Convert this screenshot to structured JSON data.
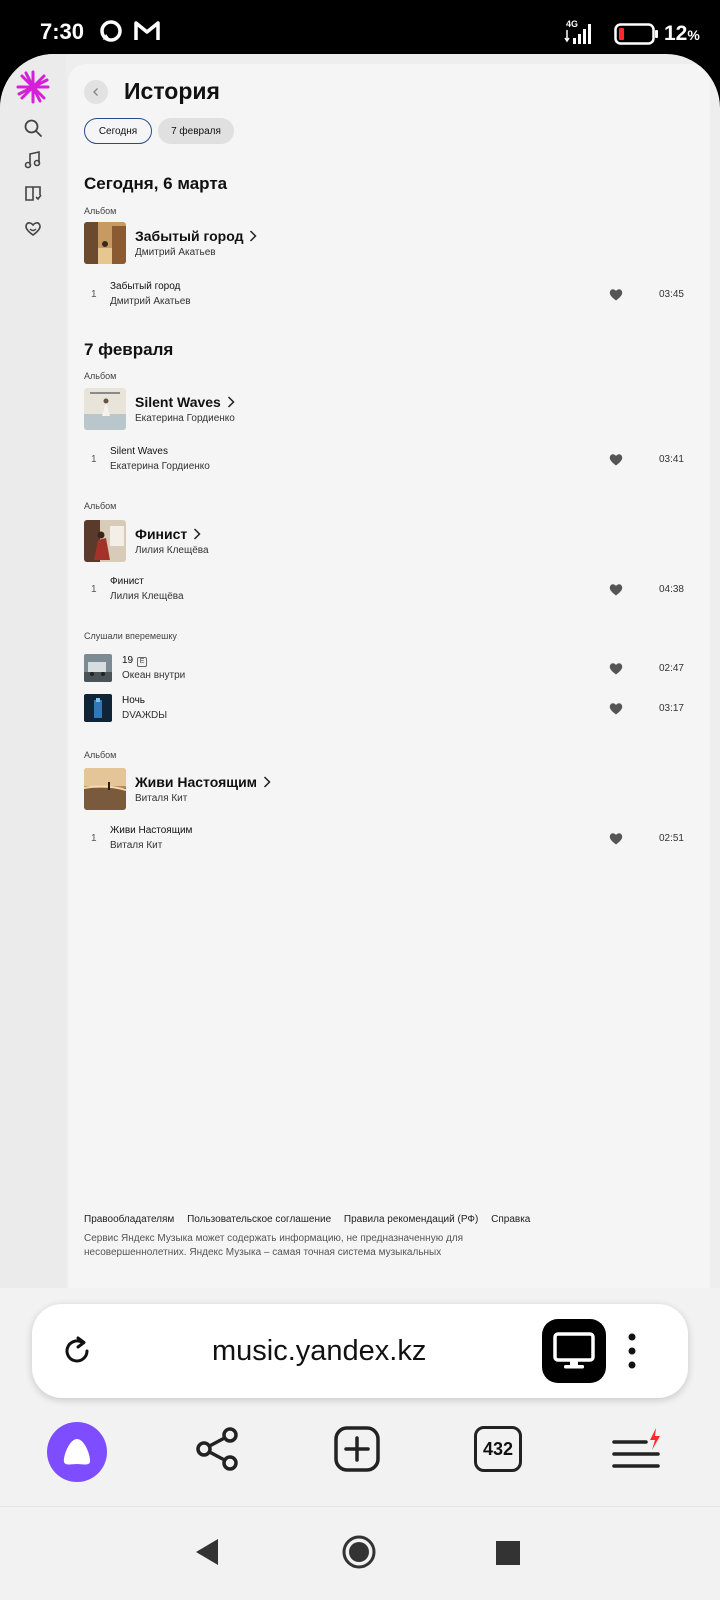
{
  "status": {
    "time": "7:30",
    "network": "4G",
    "battery": "12",
    "battery_unit": "%"
  },
  "page": {
    "title": "История"
  },
  "filters": [
    "Сегодня",
    "7 февраля"
  ],
  "sections": [
    {
      "title": "Сегодня, 6 марта",
      "group_label": "Альбом",
      "album": {
        "name": "Забытый город",
        "artist": "Дмитрий Акатьев"
      },
      "track": {
        "num": "1",
        "name": "Забытый город",
        "artist": "Дмитрий Акатьев",
        "duration": "03:45"
      }
    },
    {
      "title": "7 февраля",
      "groups": [
        {
          "label": "Альбом",
          "album": {
            "name": "Silent Waves",
            "artist": "Екатерина Гордиенко"
          },
          "track": {
            "num": "1",
            "name": "Silent Waves",
            "artist": "Екатерина Гордиенко",
            "duration": "03:41"
          }
        },
        {
          "label": "Альбом",
          "album": {
            "name": "Финист",
            "artist": "Лилия Клещёва"
          },
          "track": {
            "num": "1",
            "name": "Финист",
            "artist": "Лилия Клещёва",
            "duration": "04:38"
          }
        },
        {
          "label": "Слушали вперемешку",
          "tracks": [
            {
              "name": "19",
              "explicit": "E",
              "artist": "Океан внутри",
              "duration": "02:47"
            },
            {
              "name": "Ночь",
              "artist": "DVAЖDЫ",
              "duration": "03:17"
            }
          ]
        },
        {
          "label": "Альбом",
          "album": {
            "name": "Живи Настоящим",
            "artist": "Виталя Кит"
          },
          "track": {
            "num": "1",
            "name": "Живи Настоящим",
            "artist": "Виталя Кит",
            "duration": "02:51"
          }
        }
      ]
    }
  ],
  "footer": {
    "links": [
      "Правообладателям",
      "Пользовательское соглашение",
      "Правила рекомендаций (РФ)",
      "Справка"
    ],
    "disclaimer": "Сервис Яндекс Музыка может содержать информацию, не предназначенную для несовершеннолетних. Яндекс Музыка – самая точная система музыкальных"
  },
  "browser": {
    "url": "music.yandex.kz",
    "tabs_count": "432"
  },
  "colors": {
    "accent": "#7d4dff",
    "chip_border": "#2a4a8a",
    "logo": "#d51fd8",
    "alert": "#ff2a2a"
  }
}
